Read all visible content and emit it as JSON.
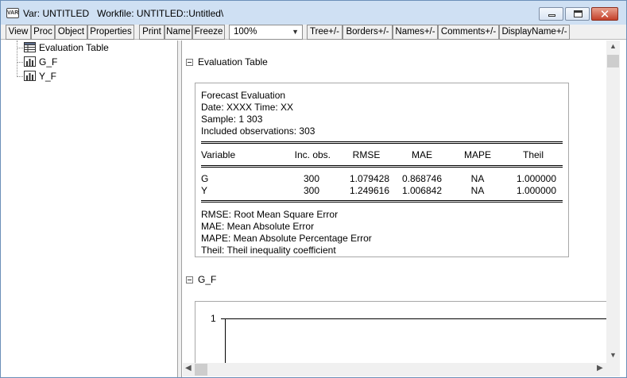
{
  "window": {
    "title": "Var: UNTITLED   Workfile: UNTITLED::Untitled\\",
    "icon_text": "VAR",
    "close_glyph": "✕"
  },
  "toolbar": {
    "buttons": [
      "View",
      "Proc",
      "Object",
      "Properties",
      "Print",
      "Name",
      "Freeze"
    ],
    "zoom_value": "100%",
    "toggles": [
      "Tree+/-",
      "Borders+/-",
      "Names+/-",
      "Comments+/-",
      "DisplayName+/-"
    ]
  },
  "tree": {
    "items": [
      {
        "label": "Evaluation Table",
        "icon": "table-icon"
      },
      {
        "label": "G_F",
        "icon": "graph-icon"
      },
      {
        "label": "Y_F",
        "icon": "graph-icon"
      }
    ]
  },
  "sections": {
    "eval_title": "Evaluation Table",
    "gf_title": "G_F"
  },
  "evaluation": {
    "heading": "Forecast Evaluation",
    "date_line": "Date: XXXX   Time: XX",
    "sample_line": "Sample: 1 303",
    "obs_line": "Included observations: 303",
    "columns": [
      "Variable",
      "Inc. obs.",
      "RMSE",
      "MAE",
      "MAPE",
      "Theil"
    ],
    "rows": [
      [
        "G",
        "300",
        "1.079428",
        "0.868746",
        "NA",
        "1.000000"
      ],
      [
        "Y",
        "300",
        "1.249616",
        "1.006842",
        "NA",
        "1.000000"
      ]
    ],
    "notes": [
      "RMSE:  Root Mean Square Error",
      "MAE:  Mean Absolute Error",
      "MAPE:  Mean Absolute Percentage Error",
      "Theil:  Theil inequality coefficient"
    ]
  },
  "chart_data": {
    "type": "line",
    "title": "G_F",
    "y_ticks": [
      "1"
    ],
    "series": []
  },
  "colors": {
    "titlebar": "#cfe0f3",
    "toolbar": "#f0f0f0",
    "close_button": "#c4402a"
  }
}
